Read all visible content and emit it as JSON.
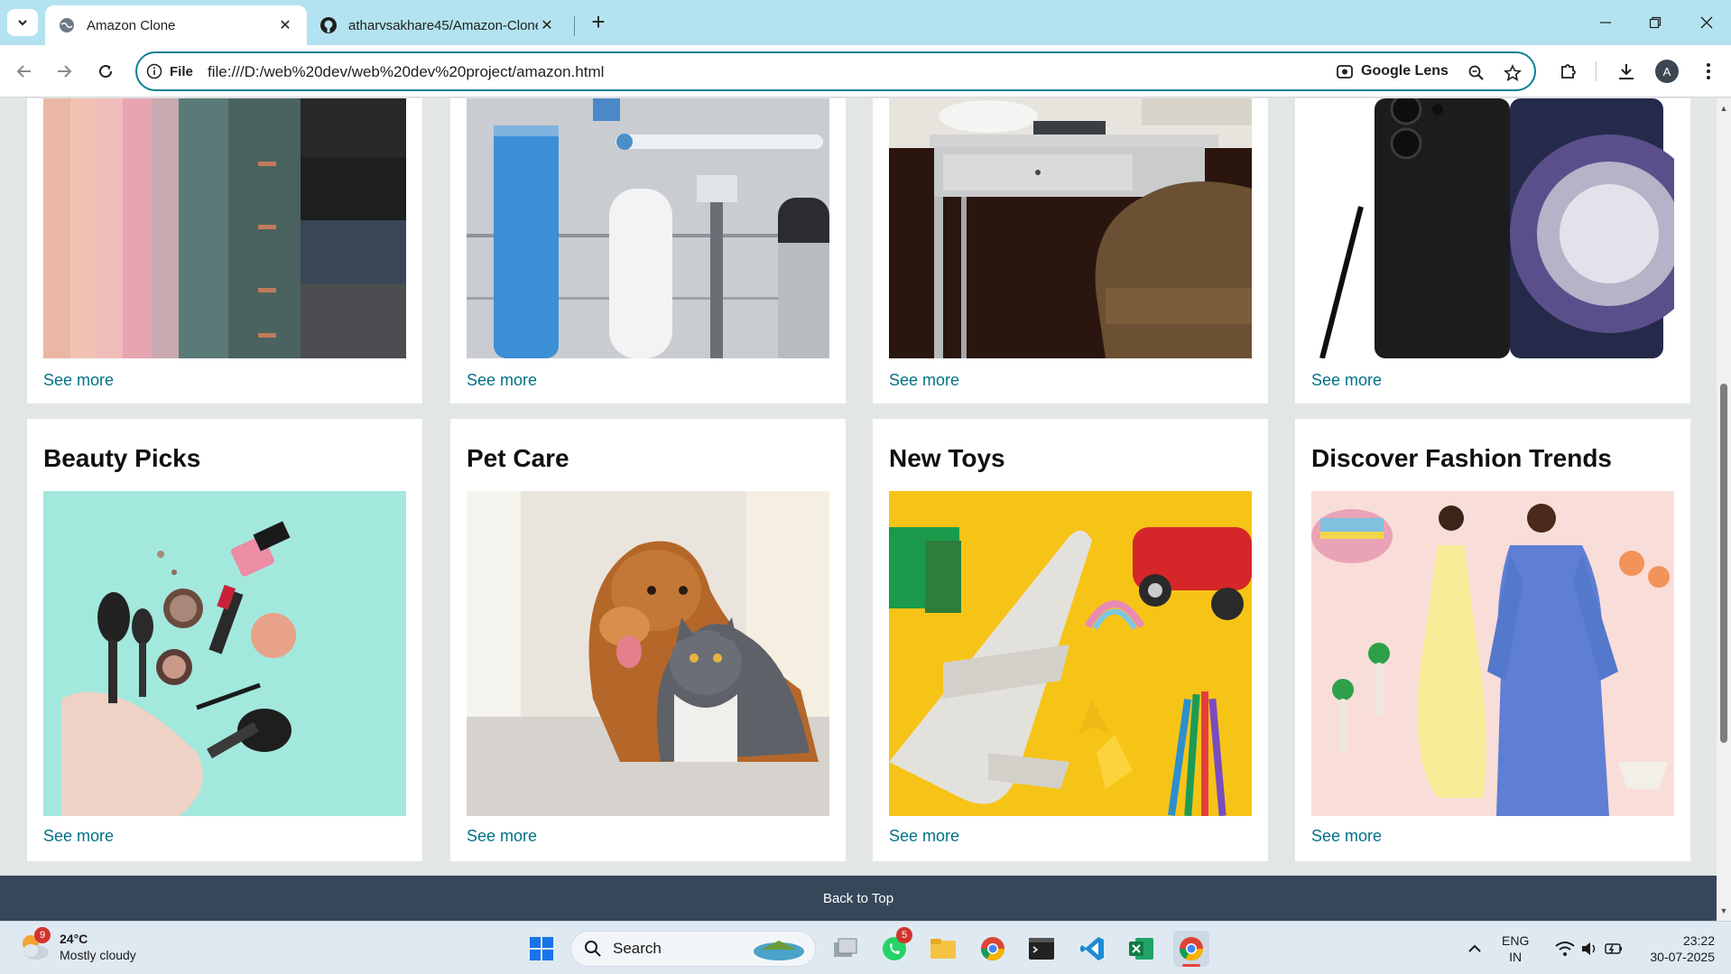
{
  "browser": {
    "tabs": [
      {
        "title": "Amazon Clone",
        "active": true
      },
      {
        "title": "atharvsakhare45/Amazon-Clone",
        "active": false
      }
    ],
    "site_info_label": "File",
    "url": "file:///D:/web%20dev/web%20dev%20project/amazon.html",
    "lens_label": "Google Lens",
    "profile_initial": "A"
  },
  "cards_top": [
    {
      "see_more": "See more",
      "image": "fabric-curtains"
    },
    {
      "see_more": "See more",
      "image": "personal-care-products"
    },
    {
      "see_more": "See more",
      "image": "desk-and-chair"
    },
    {
      "see_more": "See more",
      "image": "samsung-phone"
    }
  ],
  "cards_bottom": [
    {
      "title": "Beauty Picks",
      "see_more": "See more",
      "image": "makeup"
    },
    {
      "title": "Pet Care",
      "see_more": "See more",
      "image": "dog-and-cat"
    },
    {
      "title": "New Toys",
      "see_more": "See more",
      "image": "toys"
    },
    {
      "title": "Discover Fashion Trends",
      "see_more": "See more",
      "image": "fashion"
    }
  ],
  "footer": {
    "back_to_top": "Back to Top"
  },
  "taskbar": {
    "weather_temp": "24°C",
    "weather_desc": "Mostly cloudy",
    "weather_badge": "9",
    "search_label": "Search",
    "whatsapp_badge": "5",
    "lang_line1": "ENG",
    "lang_line2": "IN",
    "time": "23:22",
    "date": "30-07-2025"
  },
  "colors": {
    "link": "#007185",
    "back_to_top_bg": "#37475a",
    "page_bg": "#e3e6e6",
    "tab_strip": "#b3e3f0"
  }
}
